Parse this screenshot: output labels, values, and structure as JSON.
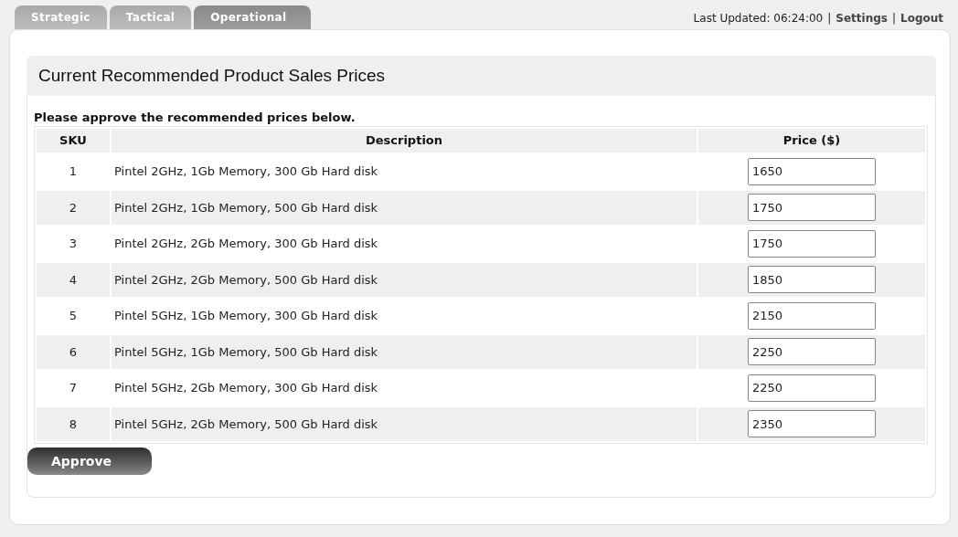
{
  "tabs": [
    {
      "label": "Strategic",
      "selected": false
    },
    {
      "label": "Tactical",
      "selected": false
    },
    {
      "label": "Operational",
      "selected": true
    }
  ],
  "header": {
    "last_updated": "Last Updated: 06:24:00",
    "separator_1": "|",
    "settings": "Settings",
    "separator_2": "|",
    "logout": "Logout"
  },
  "title": "Current Recommended Product Sales Prices",
  "instruction": "Please approve the recommended prices below.",
  "table": {
    "columns": [
      "SKU",
      "Description",
      "Price ($)"
    ],
    "rows": [
      {
        "sku": "1",
        "description": "Pintel 2GHz, 1Gb Memory, 300 Gb Hard disk",
        "price": "1650"
      },
      {
        "sku": "2",
        "description": "Pintel 2GHz, 1Gb Memory, 500 Gb Hard disk",
        "price": "1750"
      },
      {
        "sku": "3",
        "description": "Pintel 2GHz, 2Gb Memory, 300 Gb Hard disk",
        "price": "1750"
      },
      {
        "sku": "4",
        "description": "Pintel 2GHz, 2Gb Memory, 500 Gb Hard disk",
        "price": "1850"
      },
      {
        "sku": "5",
        "description": "Pintel 5GHz, 1Gb Memory, 300 Gb Hard disk",
        "price": "2150"
      },
      {
        "sku": "6",
        "description": "Pintel 5GHz, 1Gb Memory, 500 Gb Hard disk",
        "price": "2250"
      },
      {
        "sku": "7",
        "description": "Pintel 5GHz, 2Gb Memory, 300 Gb Hard disk",
        "price": "2250"
      },
      {
        "sku": "8",
        "description": "Pintel 5GHz, 2Gb Memory, 500 Gb Hard disk",
        "price": "2350"
      }
    ]
  },
  "buttons": [
    "Approve"
  ]
}
